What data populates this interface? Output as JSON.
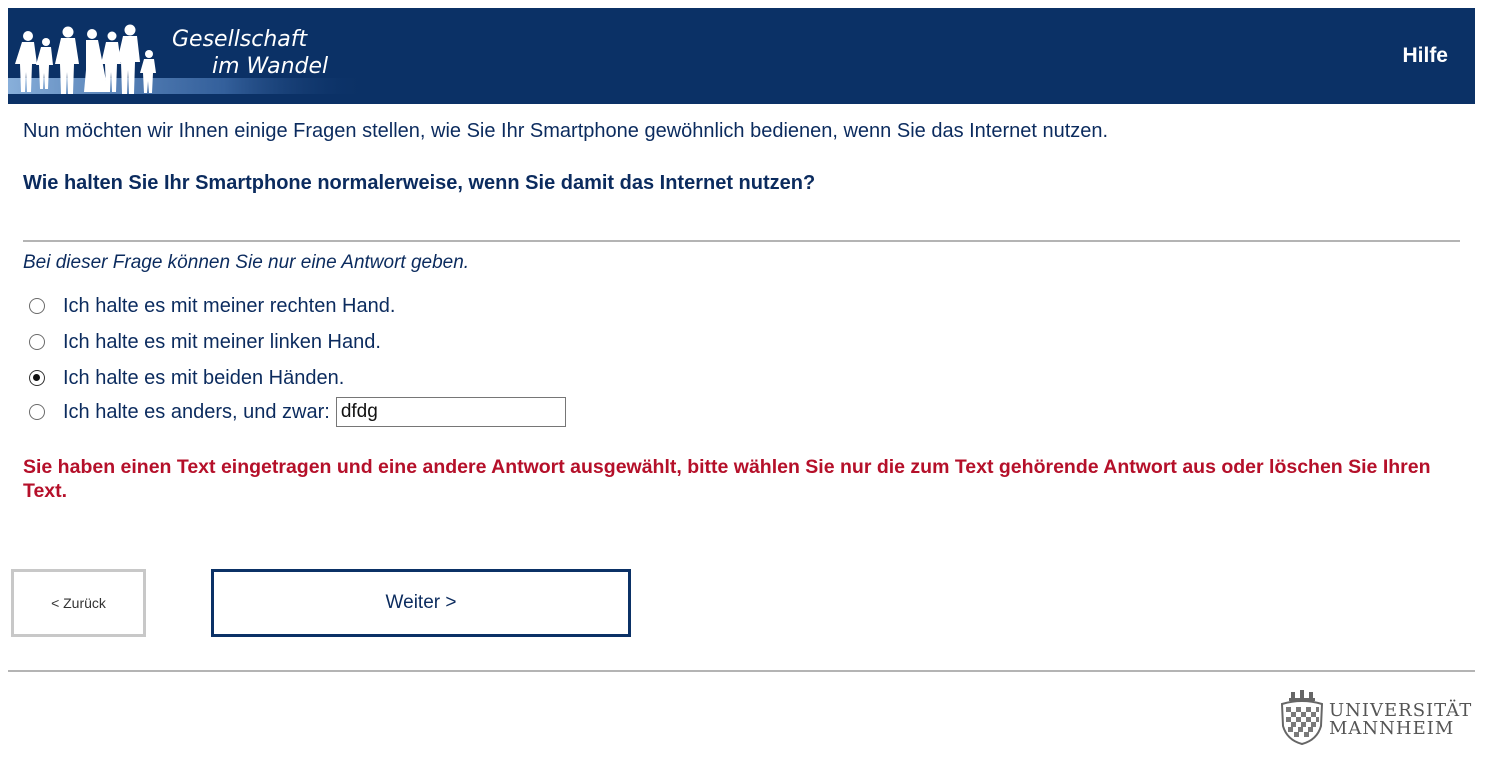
{
  "header": {
    "logo": {
      "line1": "Gesellschaft",
      "line2": "im Wandel"
    },
    "help_label": "Hilfe"
  },
  "intro_text": "Nun möchten wir Ihnen einige Fragen stellen, wie Sie Ihr Smartphone gewöhnlich bedienen, wenn Sie das Internet nutzen.",
  "question_text": "Wie halten Sie Ihr Smartphone normalerweise, wenn Sie damit das Internet nutzen?",
  "instruction_text": "Bei dieser Frage können Sie nur eine Antwort geben.",
  "options": [
    {
      "label": "Ich halte es mit meiner rechten Hand.",
      "selected": false
    },
    {
      "label": "Ich halte es mit meiner linken Hand.",
      "selected": false
    },
    {
      "label": "Ich halte es mit beiden Händen.",
      "selected": true
    },
    {
      "label": "Ich halte es anders, und zwar:",
      "selected": false,
      "text_value": "dfdg"
    }
  ],
  "error_text": "Sie haben einen Text eingetragen und eine andere Antwort ausgewählt, bitte wählen Sie nur die zum Text gehörende Antwort aus oder löschen Sie Ihren Text.",
  "navigation": {
    "back_label": "< Zurück",
    "next_label": "Weiter >"
  },
  "footer": {
    "university_line1": "UNIVERSITÄT",
    "university_line2": "MANNHEIM"
  },
  "colors": {
    "header_bg": "#0b3166",
    "text": "#0b2b5e",
    "error": "#b5102a",
    "divider": "#b4b4b4"
  }
}
